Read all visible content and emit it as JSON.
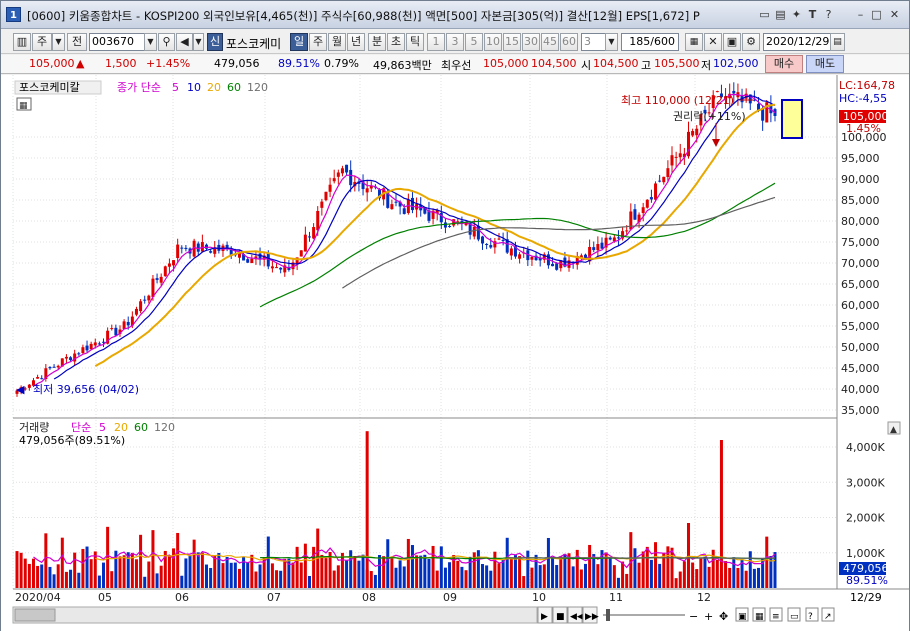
{
  "title": {
    "number": "1",
    "text": "[0600] 키움종합차트 - KOSPI200 외국인보유[4,465(천)] 주식수[60,988(천)] 액면[500] 자본금[305(억)] 결산[12월] EPS[1,672] P"
  },
  "toolbar": {
    "type_label": "주",
    "prev_label": "전",
    "code": "003670",
    "name": "포스코케미",
    "sin": "신",
    "periods": [
      "일",
      "주",
      "월",
      "년",
      "분",
      "초",
      "틱"
    ],
    "minutes": [
      "1",
      "3",
      "5",
      "10",
      "15",
      "30",
      "45",
      "60"
    ],
    "interval": "3",
    "count": "185/600",
    "date": "2020/12/29"
  },
  "quote": {
    "price": "105,000",
    "change": "1,500",
    "rate": "+1.45%",
    "volume": "479,056",
    "vol_ratio": "89.51%",
    "turnover": "0.79%",
    "amount": "49,863백만",
    "priority_label": "최우선",
    "ask": "105,000",
    "bid": "104,500",
    "open_label": "시",
    "open": "104,500",
    "high_label": "고",
    "high": "105,500",
    "low_label": "저",
    "low": "102,500",
    "buy": "매수",
    "sell": "매도"
  },
  "price_panel": {
    "name": "포스코케미칼",
    "ma_label": "종가 단순",
    "ma": [
      "5",
      "10",
      "20",
      "60",
      "120"
    ],
    "ma_colors": [
      "#d000d0",
      "#0000c0",
      "#e8a800",
      "#008000",
      "#606060"
    ],
    "high_note": "최고 110,000 (12/21)",
    "low_note": "최저 39,656 (04/02)",
    "ex_right": "권리락(+11%)",
    "lc": "LC:164,78",
    "hc": "HC:-4,55",
    "last": "105,000",
    "last_rate": "1.45%",
    "yticks": [
      "100,000",
      "95,000",
      "90,000",
      "85,000",
      "80,000",
      "75,000",
      "70,000",
      "65,000",
      "60,000",
      "55,000",
      "50,000",
      "45,000",
      "40,000",
      "35,000"
    ]
  },
  "volume_panel": {
    "name": "거래량",
    "ma_label": "단순",
    "ma": [
      "5",
      "20",
      "60",
      "120"
    ],
    "ma_colors": [
      "#d000d0",
      "#e8a800",
      "#008000",
      "#606060"
    ],
    "current": "479,056주(89.51%)",
    "last": "479,056",
    "last_rate": "89.51%",
    "yticks": [
      "4,000K",
      "3,000K",
      "2,000K",
      "1,000K"
    ]
  },
  "xaxis": {
    "labels": [
      "2020/04",
      "05",
      "06",
      "07",
      "08",
      "09",
      "10",
      "11",
      "12"
    ],
    "right_label": "12/29"
  },
  "chart_data": {
    "type": "candlestick",
    "period": "2020/04 - 2020/12/29 (daily)",
    "y_range": [
      34000,
      115000
    ],
    "volume_range": [
      0,
      4700000
    ],
    "key_points": [
      {
        "date": "04/02",
        "price": 39656,
        "note": "low"
      },
      {
        "date": "05",
        "price": 48000
      },
      {
        "date": "06",
        "price": 55000
      },
      {
        "date": "06 end",
        "price": 74000
      },
      {
        "date": "07",
        "price": 73000
      },
      {
        "date": "07 end",
        "price": 68000
      },
      {
        "date": "08",
        "price": 92000
      },
      {
        "date": "09",
        "price": 84000
      },
      {
        "date": "10",
        "price": 80000
      },
      {
        "date": "10 end",
        "price": 74000
      },
      {
        "date": "11",
        "price": 70000
      },
      {
        "date": "11 end",
        "price": 75000
      },
      {
        "date": "12",
        "price": 92000
      },
      {
        "date": "12/21",
        "price": 110000,
        "note": "high"
      },
      {
        "date": "12/29",
        "price": 105000
      }
    ],
    "volume_peaks": [
      {
        "date": "08",
        "volume": 4450000
      },
      {
        "date": "12",
        "volume": 4200000
      }
    ]
  }
}
